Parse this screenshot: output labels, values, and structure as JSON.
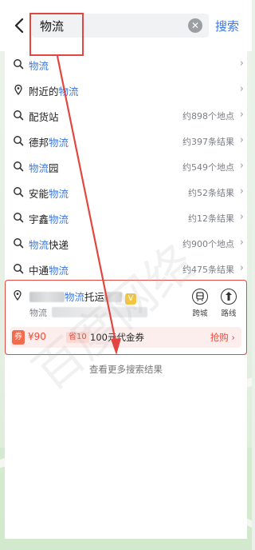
{
  "header": {
    "query": "物流",
    "clear_label": "✕",
    "search_label": "搜索"
  },
  "suggestions": [
    {
      "parts": [
        {
          "t": "物流",
          "hl": true
        }
      ],
      "meta": ""
    },
    {
      "parts": [
        {
          "t": "附近的",
          "hl": false
        },
        {
          "t": "物流",
          "hl": true
        }
      ],
      "meta": ""
    },
    {
      "parts": [
        {
          "t": "配货站",
          "hl": false
        }
      ],
      "meta": "约898个地点"
    },
    {
      "parts": [
        {
          "t": "德邦",
          "hl": false
        },
        {
          "t": "物流",
          "hl": true
        }
      ],
      "meta": "约397条结果"
    },
    {
      "parts": [
        {
          "t": "物流",
          "hl": true
        },
        {
          "t": "园",
          "hl": false
        }
      ],
      "meta": "约549个地点"
    },
    {
      "parts": [
        {
          "t": "安能",
          "hl": false
        },
        {
          "t": "物流",
          "hl": true
        }
      ],
      "meta": "约52条结果"
    },
    {
      "parts": [
        {
          "t": "宇鑫",
          "hl": false
        },
        {
          "t": "物流",
          "hl": true
        }
      ],
      "meta": "约12条结果"
    },
    {
      "parts": [
        {
          "t": "物流",
          "hl": true
        },
        {
          "t": "快递",
          "hl": false
        }
      ],
      "meta": "约900个地点"
    },
    {
      "parts": [
        {
          "t": "中通",
          "hl": false
        },
        {
          "t": "物流",
          "hl": true
        }
      ],
      "meta": "约475条结果"
    }
  ],
  "poi": {
    "name_hl": "物流",
    "name_rest": "托运",
    "name_tail": "",
    "badge": "V",
    "category": "物流",
    "actions": [
      {
        "label": "跨城",
        "icon": "bus-icon"
      },
      {
        "label": "路线",
        "icon": "route-icon"
      }
    ],
    "coupon": {
      "tag": "券",
      "price": "¥90",
      "save": "省10",
      "name": "100元代金券",
      "buy": "抢购"
    }
  },
  "more_results": "查看更多搜索结果",
  "chevron": "›",
  "colors": {
    "accent": "#3a78e6",
    "annotation": "#e14641",
    "coupon": "#ef4a38"
  }
}
